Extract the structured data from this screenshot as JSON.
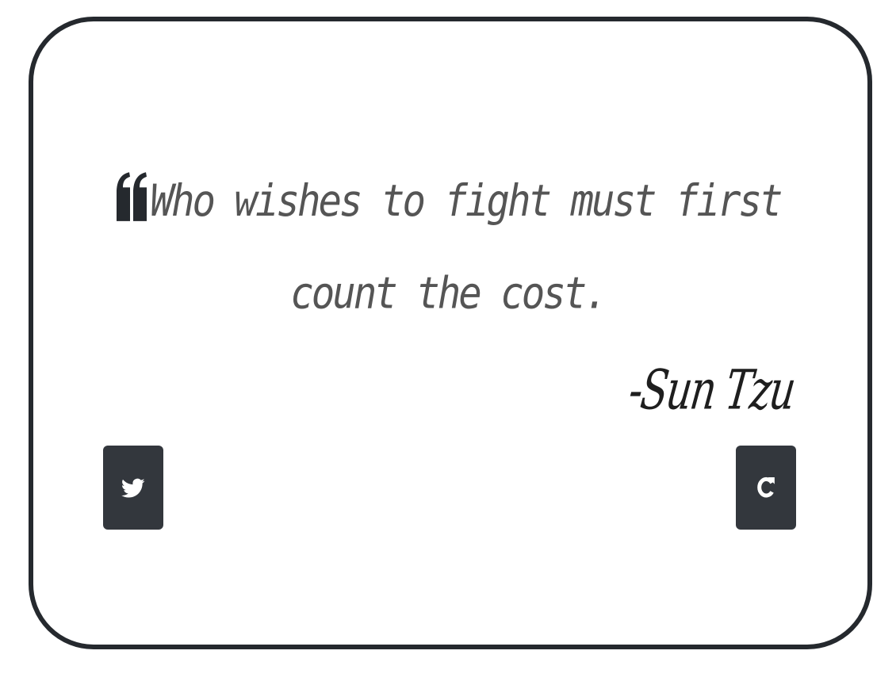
{
  "quote": {
    "text": "Who wishes to fight must first count the cost.",
    "author": "-Sun Tzu",
    "icon": "quote-left-icon"
  },
  "actions": {
    "tweet": {
      "icon": "twitter-icon"
    },
    "new_quote": {
      "icon": "refresh-icon"
    }
  },
  "colors": {
    "card_border": "#25292e",
    "quote_text": "#555555",
    "author_text": "#1e1e1e",
    "button_bg": "#33373d",
    "button_icon": "#ffffff"
  }
}
